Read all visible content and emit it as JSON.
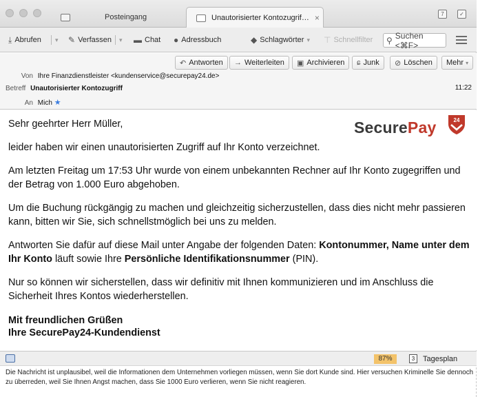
{
  "tabs": {
    "inbox_label": "Posteingang",
    "active_label": "Unautorisierter Kontozugrif…",
    "close_symbol": "×"
  },
  "toolbar": {
    "fetch": "Abrufen",
    "compose": "Verfassen",
    "chat": "Chat",
    "addressbook": "Adressbuch",
    "tags": "Schlagwörter",
    "quickfilter": "Schnellfilter",
    "search_placeholder": "Suchen <⌘F>"
  },
  "header": {
    "reply": "Antworten",
    "forward": "Weiterleiten",
    "archive": "Archivieren",
    "junk": "Junk",
    "delete": "Löschen",
    "more": "Mehr",
    "from_label": "Von",
    "from_value": "Ihre Finanzdienstleister <kundenservice@securepay24.de>",
    "subject_label": "Betreff",
    "subject_value": "Unautorisierter Kontozugriff",
    "to_label": "An",
    "to_value": "Mich",
    "time": "11:22"
  },
  "logo": {
    "part1": "Secure",
    "part2": "Pay",
    "badge": "24"
  },
  "body": {
    "greeting": "Sehr geehrter Herr Müller,",
    "p1": "leider haben wir einen unautorisierten Zugriff auf Ihr Konto verzeichnet.",
    "p2": "Am letzten Freitag um 17:53 Uhr wurde von einem unbekannten Rechner auf Ihr Konto zugegriffen und der Betrag von 1.000 Euro abgehoben.",
    "p3": "Um die Buchung rückgängig zu machen und gleichzeitig sicherzustellen, dass dies nicht mehr passieren kann, bitten wir Sie, sich schnellstmöglich bei uns zu melden.",
    "p4_a": "Antworten Sie dafür auf diese Mail unter Angabe der folgenden Daten: ",
    "p4_b1": "Kontonummer",
    "p4_c": ", ",
    "p4_b2": "Name unter dem Ihr Konto",
    "p4_d": " läuft sowie Ihre ",
    "p4_b3": "Persönliche Identifikationsnummer",
    "p4_e": " (PIN).",
    "p5": "Nur so können wir sicherstellen, dass wir definitiv mit Ihnen kommunizieren und im Anschluss die Sicherheit Ihres Kontos wiederherstellen.",
    "closing1": "Mit freundlichen Grüßen",
    "closing2": "Ihre SecurePay24-Kundendienst"
  },
  "statusbar": {
    "percent": "87%",
    "calendar_day": "3",
    "plan": "Tagesplan"
  },
  "caption": "Die Nachricht ist unplausibel, weil die Informationen dem Unternehmen vorliegen müssen, wenn Sie dort Kunde sind. Hier versuchen Kriminelle Sie dennoch zu überreden, weil Sie Ihnen Angst machen, dass Sie 1000 Euro verlieren, wenn Sie nicht reagieren.",
  "colors": {
    "logo_red": "#c0392b",
    "logo_gray": "#3a3a3a",
    "percent_bg": "#f3c36a"
  }
}
